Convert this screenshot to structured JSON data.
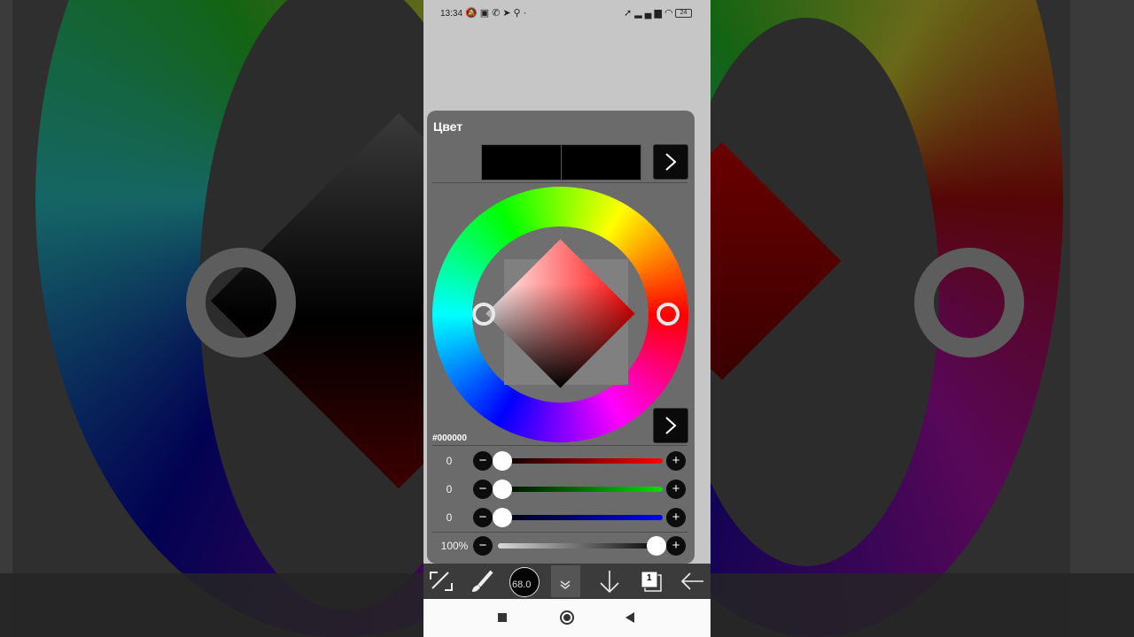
{
  "status_bar": {
    "time": "13:34",
    "battery": "24",
    "left_icons": [
      "mute-icon",
      "nfc-icon",
      "whatsapp-icon",
      "telegram-icon",
      "location-icon",
      "dot-icon"
    ],
    "right_icons": [
      "location-arrow-icon",
      "signal-icon",
      "wifi-icon",
      "battery-icon"
    ]
  },
  "color_panel": {
    "title": "Цвет",
    "current_color": "#000000",
    "previous_color": "#000000",
    "hex_value": "#000000",
    "selected_hue_color": "#ff0000",
    "channels": [
      {
        "name": "red",
        "value": "0",
        "level": 0,
        "color": "#ff0000"
      },
      {
        "name": "green",
        "value": "0",
        "level": 0,
        "color": "#00e000"
      },
      {
        "name": "blue",
        "value": "0",
        "level": 0,
        "color": "#0000ff"
      }
    ],
    "opacity": {
      "value": "100%",
      "level": 1.0
    }
  },
  "toolbar": {
    "brush_size": "68.0",
    "layer_count": "1",
    "tools": [
      "transform-icon",
      "brush-icon",
      "brush-size-indicator",
      "collapse-icon",
      "down-arrow-icon",
      "layers-icon",
      "back-arrow-icon"
    ]
  },
  "navbar": [
    "recents-button",
    "home-button",
    "back-button"
  ]
}
